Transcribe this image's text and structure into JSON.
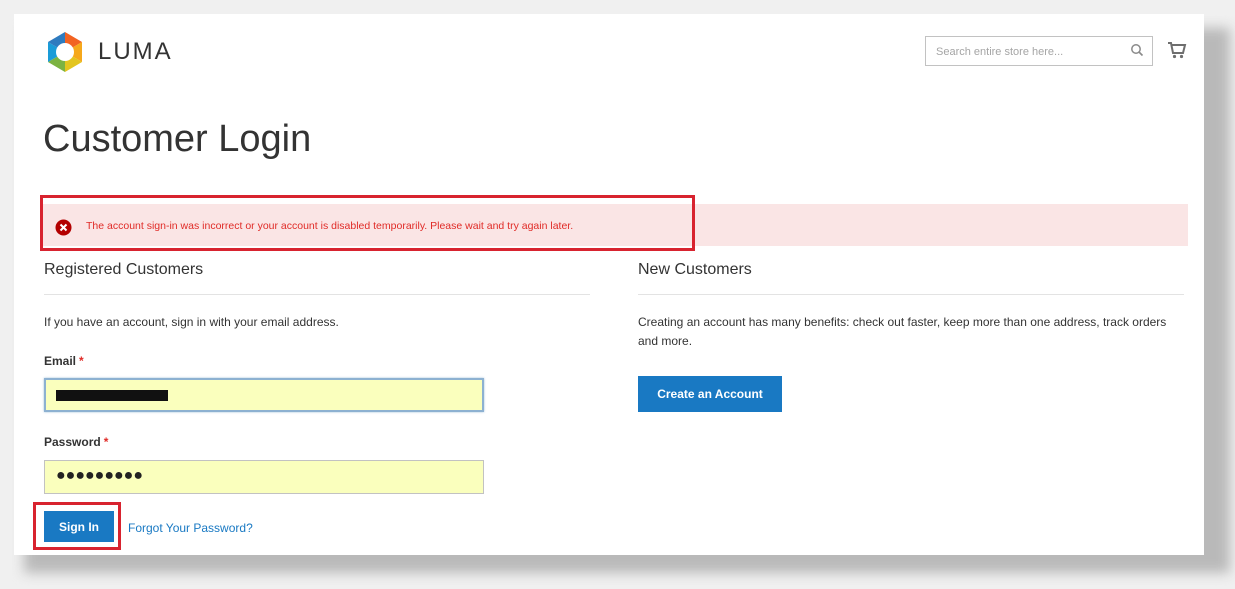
{
  "header": {
    "logo_text": "LUMA",
    "search_placeholder": "Search entire store here..."
  },
  "page_title": "Customer Login",
  "message": {
    "type": "error",
    "text": "The account sign-in was incorrect or your account is disabled temporarily. Please wait and try again later."
  },
  "registered": {
    "title": "Registered Customers",
    "intro": "If you have an account, sign in with your email address.",
    "email_label": "Email",
    "password_label": "Password",
    "required_mark": "*",
    "password_value": "●●●●●●●●●",
    "signin_label": "Sign In",
    "forgot_label": "Forgot Your Password?"
  },
  "new_customers": {
    "title": "New Customers",
    "intro": "Creating an account has many benefits: check out faster, keep more than one address, track orders and more.",
    "create_label": "Create an Account"
  },
  "colors": {
    "primary": "#1979c3",
    "error_text": "#e02b27",
    "error_bg": "#fae5e5",
    "highlight_border": "#d8232f",
    "autofill_bg": "#faffbd"
  },
  "icons": {
    "logo": "luma-logo-icon",
    "search": "search-icon",
    "cart": "cart-icon",
    "error": "error-icon"
  }
}
